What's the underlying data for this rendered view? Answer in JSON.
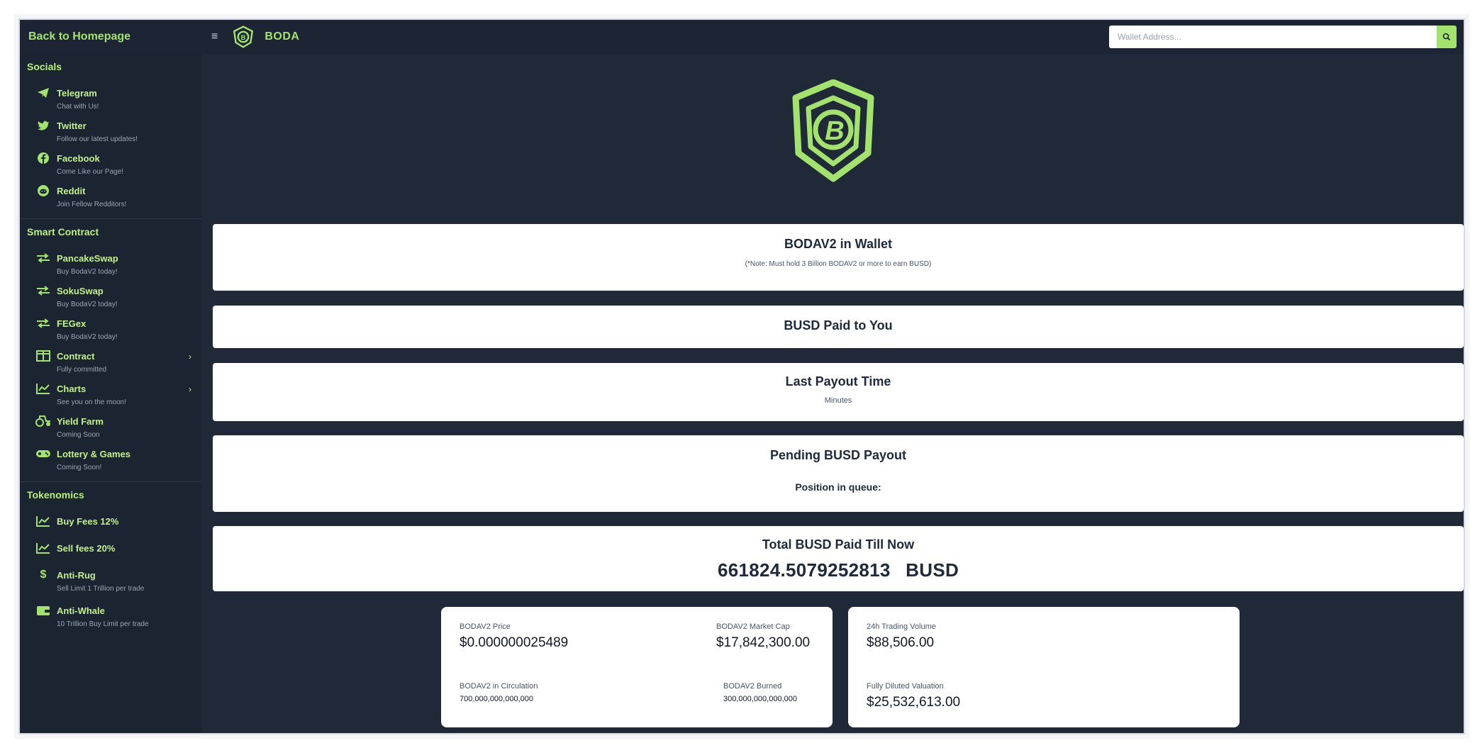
{
  "topbar": {
    "back_label": "Back to Homepage",
    "menu_glyph": "≡",
    "brand_name": "BODA",
    "search_placeholder": "Wallet Address..."
  },
  "sidebar": {
    "socials": {
      "title": "Socials",
      "items": [
        {
          "label": "Telegram",
          "sub": "Chat with Us!",
          "icon": "telegram-icon"
        },
        {
          "label": "Twitter",
          "sub": "Follow our latest updates!",
          "icon": "twitter-icon"
        },
        {
          "label": "Facebook",
          "sub": "Come Like our Page!",
          "icon": "facebook-icon"
        },
        {
          "label": "Reddit",
          "sub": "Join Fellow Redditors!",
          "icon": "reddit-icon"
        }
      ]
    },
    "smart_contract": {
      "title": "Smart Contract",
      "items": [
        {
          "label": "PancakeSwap",
          "sub": "Buy BodaV2 today!",
          "icon": "swap-icon"
        },
        {
          "label": "SokuSwap",
          "sub": "Buy BodaV2 today!",
          "icon": "swap-icon"
        },
        {
          "label": "FEGex",
          "sub": "Buy BodaV2 today!",
          "icon": "swap-icon"
        },
        {
          "label": "Contract",
          "sub": "Fully committed",
          "icon": "contract-icon"
        },
        {
          "label": "Charts",
          "sub": "See you on the moon!",
          "icon": "chart-icon"
        },
        {
          "label": "Yield Farm",
          "sub": "Coming Soon",
          "icon": "tractor-icon"
        },
        {
          "label": "Lottery & Games",
          "sub": "Coming Soon!",
          "icon": "gamepad-icon"
        }
      ]
    },
    "tokenomics": {
      "title": "Tokenomics",
      "items": [
        {
          "label": "Buy Fees 12%",
          "sub": "",
          "icon": "chart-icon"
        },
        {
          "label": "Sell fees 20%",
          "sub": "",
          "icon": "chart-icon"
        },
        {
          "label": "Anti-Rug",
          "sub": "Sell Limit 1 Trillion per trade",
          "icon": "dollar-icon"
        },
        {
          "label": "Anti-Whale",
          "sub": "10 Trillion Buy Limit per trade",
          "icon": "wallet-icon"
        }
      ]
    }
  },
  "main": {
    "wallet_card": {
      "title": "BODAV2 in Wallet",
      "note": "(*Note: Must hold 3 Billion BODAV2 or more to earn BUSD)"
    },
    "paid_card": {
      "title": "BUSD Paid to You"
    },
    "payout_time_card": {
      "title": "Last Payout Time",
      "sub": "Minutes"
    },
    "pending_card": {
      "title": "Pending BUSD Payout",
      "queue_label": "Position in queue:"
    },
    "total_card": {
      "title": "Total BUSD Paid Till Now",
      "value": "661824.5079252813",
      "unit": "BUSD"
    },
    "stats_left": {
      "price_label": "BODAV2 Price",
      "price_value": "$0.000000025489",
      "mcap_label": "BODAV2 Market Cap",
      "mcap_value": "$17,842,300.00",
      "circ_label": "BODAV2 in Circulation",
      "circ_value": "700,000,000,000,000",
      "burned_label": "BODAV2 Burned",
      "burned_value": "300,000,000,000,000"
    },
    "stats_right": {
      "volume_label": "24h Trading Volume",
      "volume_value": "$88,506.00",
      "fdv_label": "Fully Diluted Valuation",
      "fdv_value": "$25,532,613.00"
    }
  },
  "colors": {
    "accent": "#a3e36d",
    "background": "#1f2937",
    "sidebar": "#1b2431",
    "card": "#ffffff"
  }
}
